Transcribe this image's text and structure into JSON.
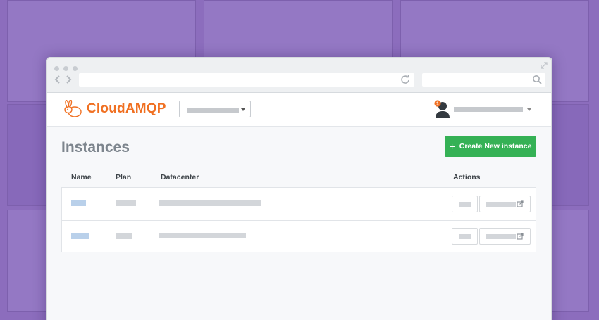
{
  "app": {
    "brand": "CloudAMQP",
    "page_title": "Instances",
    "create_button_label": "Create New instance",
    "notification_count": "1"
  },
  "table": {
    "columns": [
      "Name",
      "Plan",
      "Datacenter",
      "Actions"
    ]
  },
  "icons": {
    "logo": "rabbit-logo-icon",
    "create": "plus-icon",
    "user": "user-avatar-icon",
    "external": "external-link-icon"
  },
  "colors": {
    "brand": "#f07022",
    "create_button": "#35b155",
    "background": "#8c6dbd",
    "notification": "#f07022"
  }
}
